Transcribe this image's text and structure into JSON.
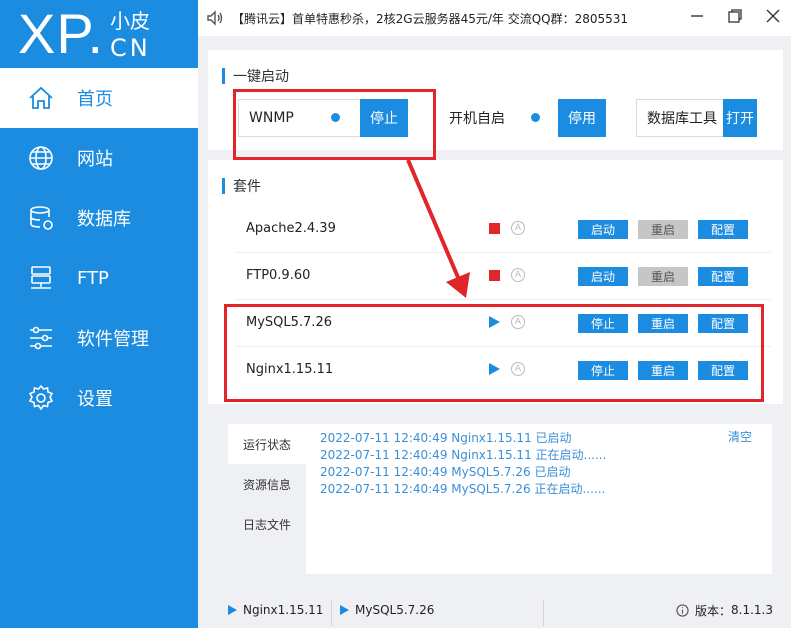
{
  "logo": {
    "xp": "XP.",
    "small": "小皮",
    "cn": "CN"
  },
  "nav": [
    {
      "label": "首页",
      "icon": "home-icon",
      "active": true
    },
    {
      "label": "网站",
      "icon": "globe-icon"
    },
    {
      "label": "数据库",
      "icon": "database-icon"
    },
    {
      "label": "FTP",
      "icon": "ftp-server-icon"
    },
    {
      "label": "软件管理",
      "icon": "sliders-icon"
    },
    {
      "label": "设置",
      "icon": "gear-icon"
    }
  ],
  "topbar": {
    "notice": "【腾讯云】首单特惠秒杀，2核2G云服务器45元/年 交流QQ群：2805531"
  },
  "quick_start": {
    "title": "一键启动",
    "wnmp": {
      "label": "WNMP",
      "button": "停止"
    },
    "autostart": {
      "label": "开机自启",
      "button": "停用"
    },
    "dbtool": {
      "label": "数据库工具",
      "button": "打开"
    }
  },
  "suites": {
    "title": "套件",
    "rows": [
      {
        "name": "Apache2.4.39",
        "status": "stopped",
        "btn1": "启动",
        "btn2": "重启",
        "btn3": "配置"
      },
      {
        "name": "FTP0.9.60",
        "status": "stopped",
        "btn1": "启动",
        "btn2": "重启",
        "btn3": "配置"
      },
      {
        "name": "MySQL5.7.26",
        "status": "running",
        "btn1": "停止",
        "btn2": "重启",
        "btn3": "配置"
      },
      {
        "name": "Nginx1.15.11",
        "status": "running",
        "btn1": "停止",
        "btn2": "重启",
        "btn3": "配置"
      }
    ]
  },
  "log": {
    "tabs": [
      "运行状态",
      "资源信息",
      "日志文件"
    ],
    "clear": "清空",
    "lines": [
      "2022-07-11 12:40:49 Nginx1.15.11 已启动",
      "2022-07-11 12:40:49 Nginx1.15.11 正在启动......",
      "2022-07-11 12:40:49 MySQL5.7.26 已启动",
      "2022-07-11 12:40:49 MySQL5.7.26 正在启动......"
    ]
  },
  "statusbar": {
    "item1": "Nginx1.15.11",
    "item2": "MySQL5.7.26",
    "version_label": "版本：",
    "version": "8.1.1.3"
  },
  "colors": {
    "primary": "#1c8ce0",
    "stop_red": "#e0262b",
    "annotation_red": "#e0262b"
  }
}
